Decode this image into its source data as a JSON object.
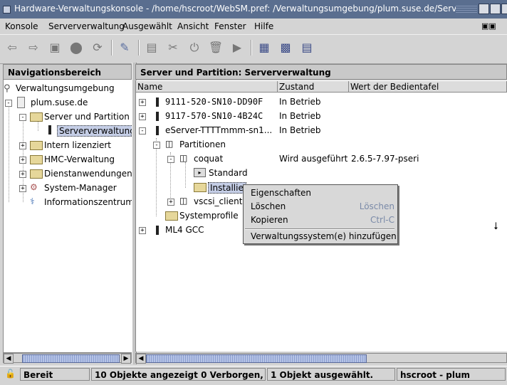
{
  "window": {
    "title": "Hardware-Verwaltungskonsole - /home/hscroot/WebSM.pref: /Verwaltungsumgebung/plum.suse.de/Server und"
  },
  "menubar": {
    "items": [
      "Konsole",
      "Serververwaltung",
      "Ausgewählt",
      "Ansicht",
      "Fenster",
      "Hilfe"
    ]
  },
  "left": {
    "header": "Navigationsbereich",
    "tree": {
      "root": "Verwaltungsumgebung",
      "host": "plum.suse.de",
      "server_partition": "Server und Partition",
      "serververwaltung": "Serververwaltung",
      "intern": "Intern lizenziert",
      "hmc": "HMC-Verwaltung",
      "dienst": "Dienstanwendungen",
      "sysman": "System-Manager",
      "info": "Informationszentrum"
    }
  },
  "right": {
    "header": "Server und Partition: Serververwaltung",
    "columns": [
      "Name",
      "Zustand",
      "Wert der Bedientafel"
    ],
    "rows": {
      "r1": {
        "name": "9111-520-SN10-DD90F",
        "state": "In Betrieb"
      },
      "r2": {
        "name": "9117-570-SN10-4B24C",
        "state": "In Betrieb"
      },
      "r3": {
        "name": "eServer-TTTTmmm-sn1...",
        "state": "In Betrieb"
      },
      "partitionen": "Partitionen",
      "coquat": {
        "name": "coquat",
        "state": "Wird ausgeführt",
        "value": "2.6.5-7.97-pseri"
      },
      "standard": "Standard",
      "installie": "Installie",
      "vscsi": "vscsi_client",
      "systemprofile": "Systemprofile",
      "ml4": "ML4 GCC"
    }
  },
  "context_menu": {
    "eigenschaften": "Eigenschaften",
    "loeschen": "Löschen",
    "loeschen_acc": "Löschen",
    "kopieren": "Kopieren",
    "kopieren_acc": "Ctrl-C",
    "hinzufuegen": "Verwaltungssystem(e) hinzufügen"
  },
  "status": {
    "ready": "Bereit",
    "objects": "10 Objekte angezeigt 0 Verborgen,",
    "selected": "1 Objekt ausgewählt.",
    "user": "hscroot - plum"
  }
}
